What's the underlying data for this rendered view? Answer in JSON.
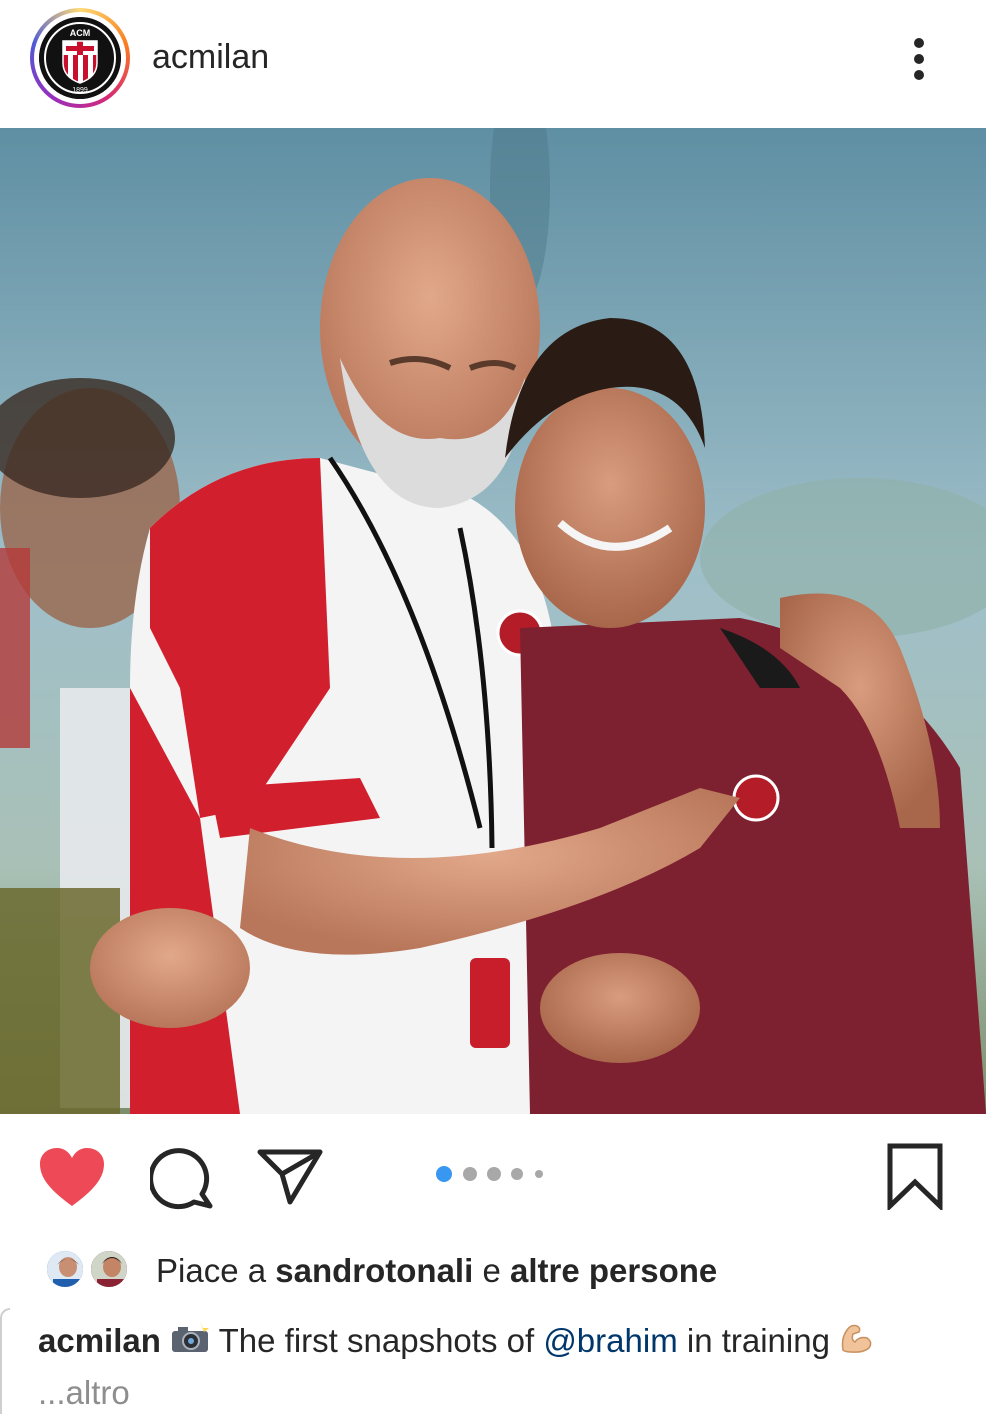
{
  "post": {
    "username": "acmilan",
    "avatar_logo": "ac-milan-crest",
    "avatar_logo_text_top": "ACM",
    "avatar_logo_text_bottom": "1899"
  },
  "photo": {
    "subject": "coach-and-player-embrace"
  },
  "actions": {
    "like_icon": "heart-filled-icon",
    "like_color": "#ed4956",
    "comment_icon": "comment-icon",
    "share_icon": "paper-plane-icon",
    "save_icon": "bookmark-icon",
    "carousel_count": 5,
    "carousel_active_index": 0,
    "carousel_active_color": "#3897f0",
    "carousel_inactive_color": "#a8a8a8"
  },
  "likes": {
    "prefix": "Piace a ",
    "user": "sandrotonali",
    "joiner": " e ",
    "others": "altre persone"
  },
  "caption": {
    "user": "acmilan",
    "emoji_1": "camera-flash-emoji",
    "text_1": " The first snapshots of ",
    "mention": "@brahim",
    "text_2": " in training ",
    "emoji_2": "flexed-biceps-emoji",
    "more": "...altro"
  },
  "colors": {
    "text": "#262626",
    "mention": "#00376b",
    "secondary": "#8e8e8e"
  }
}
